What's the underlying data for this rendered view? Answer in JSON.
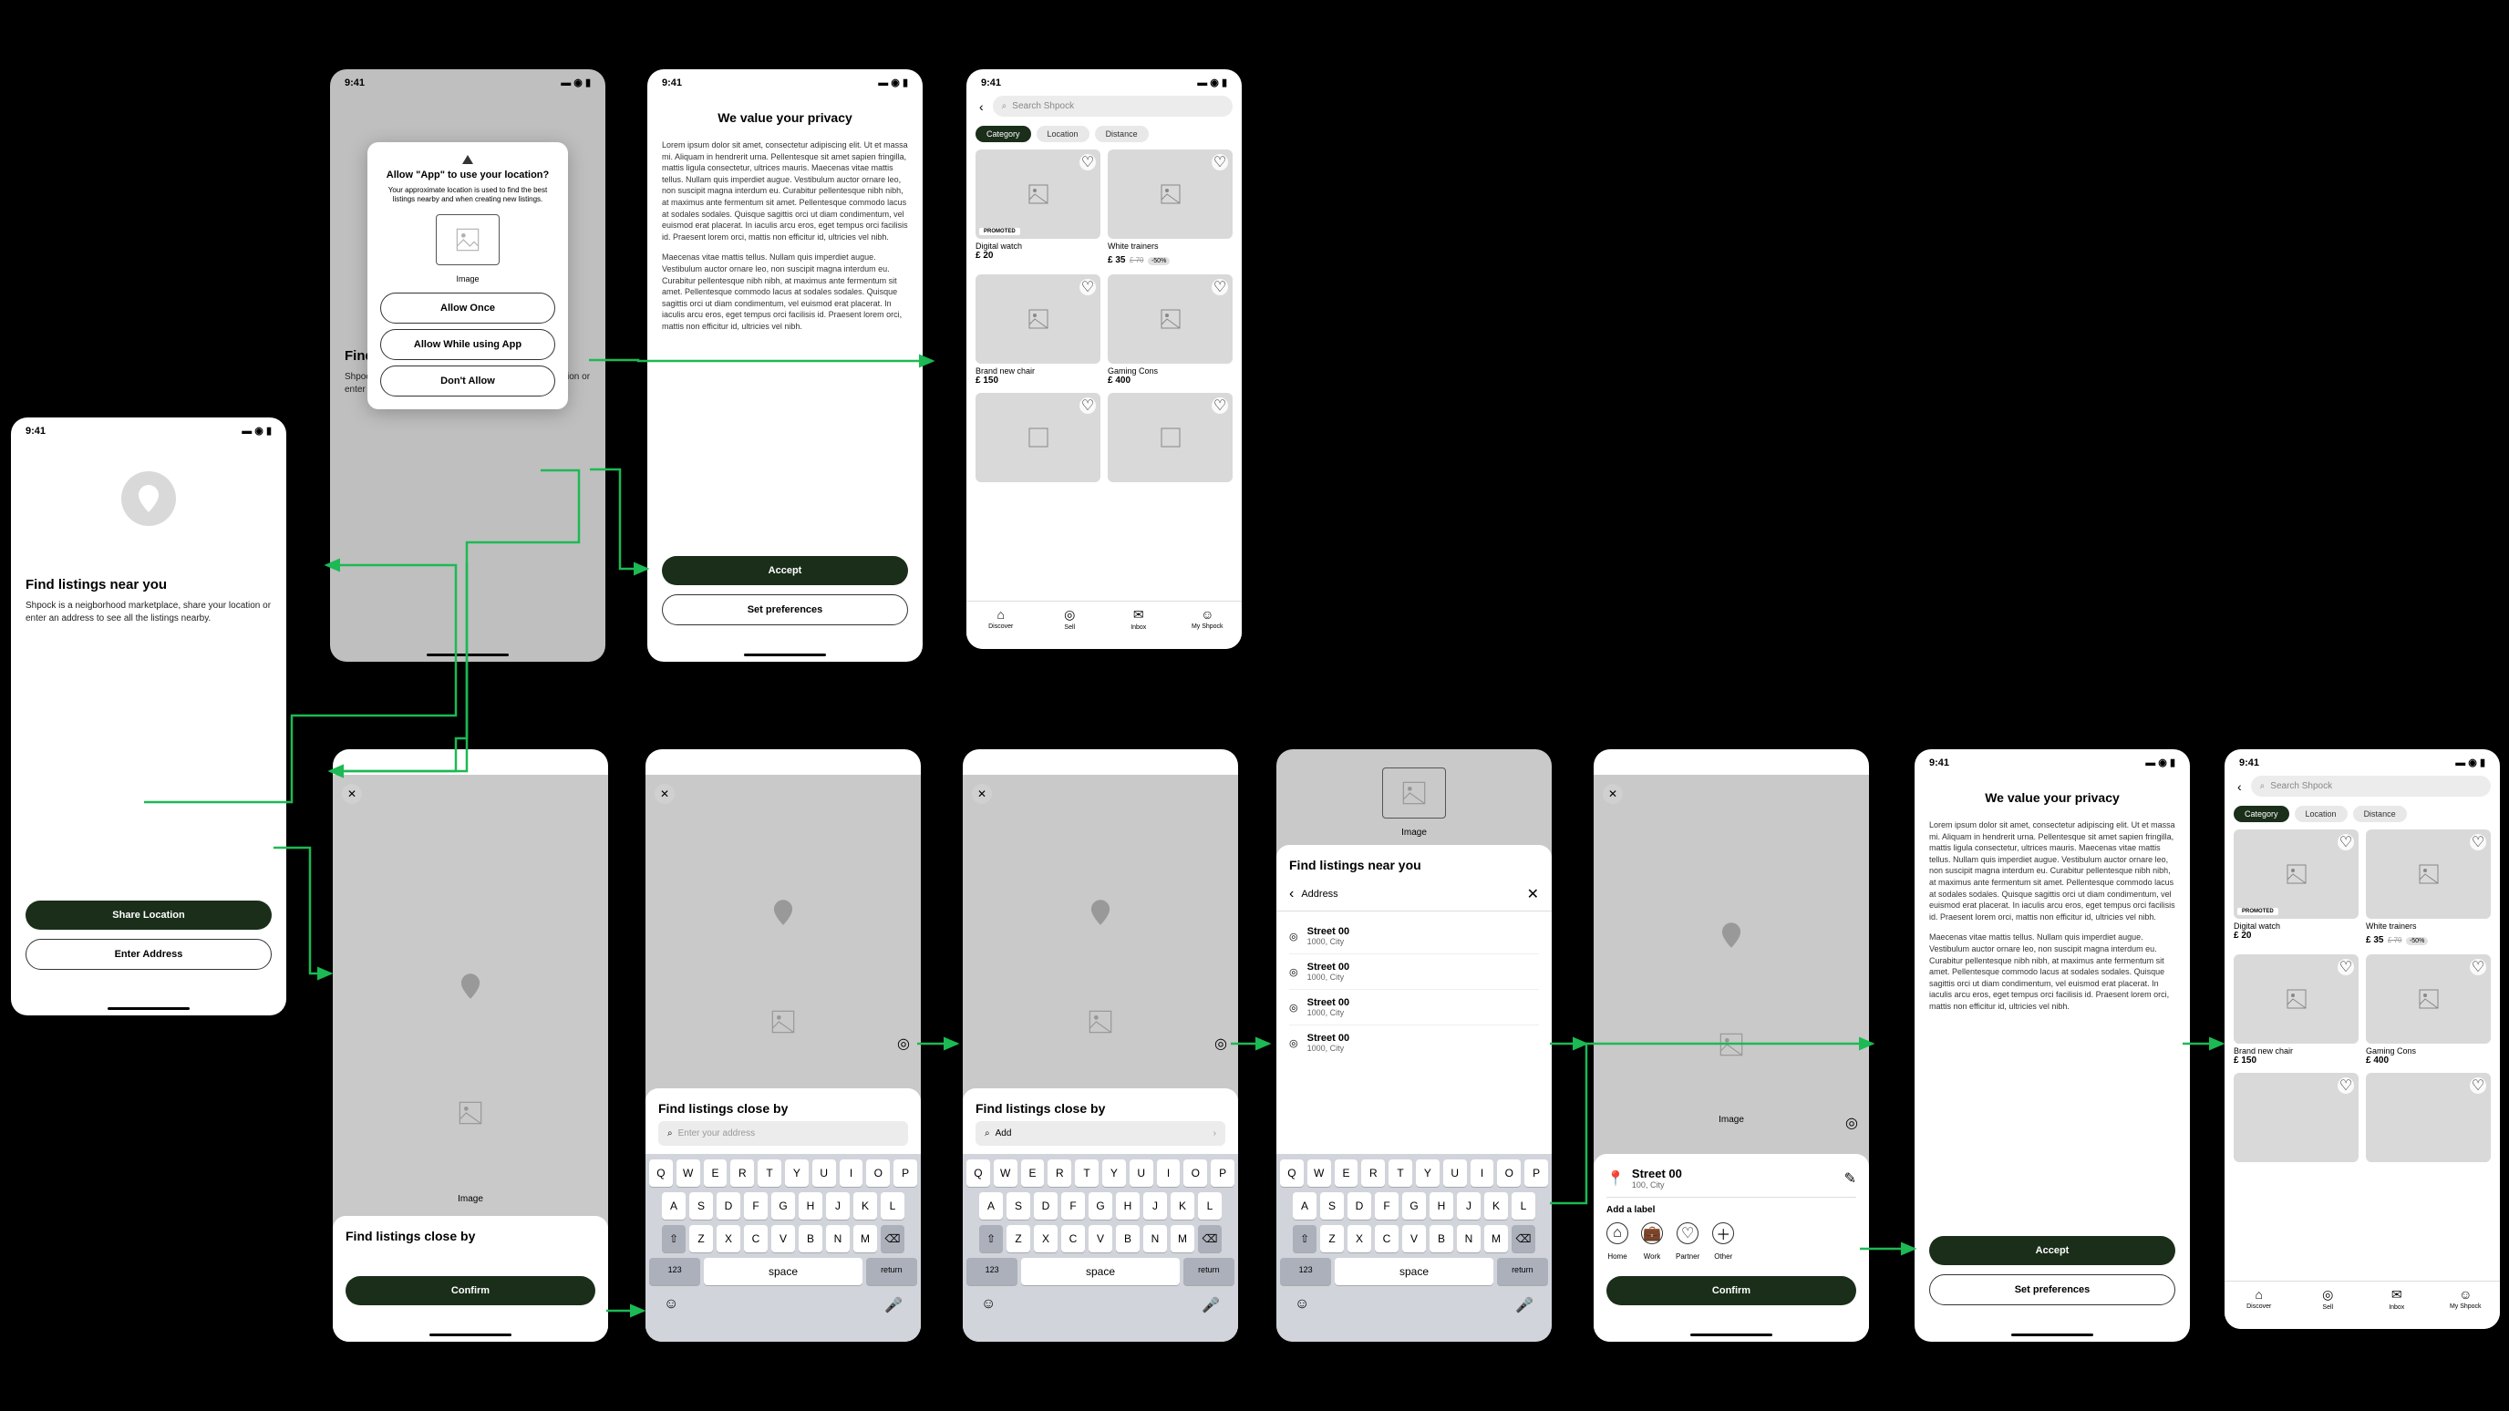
{
  "status_time": "9:41",
  "screen1": {
    "title": "Find listings near you",
    "body": "Shpock is a neigborhood marketplace, share your location or enter an address to see all the listings nearby.",
    "btn_share": "Share Location",
    "btn_enter": "Enter Address"
  },
  "screen2": {
    "dialog_title": "Allow \"App\" to use your location?",
    "dialog_body": "Your approximate location is used to find the best listings nearby and when creating new listings.",
    "image_label": "Image",
    "btn_once": "Allow Once",
    "btn_while": "Allow While using App",
    "btn_deny": "Don't Allow",
    "bg_title": "Find "
  },
  "privacy": {
    "title": "We value your privacy",
    "body1": "Lorem ipsum dolor sit amet, consectetur adipiscing elit. Ut et massa mi. Aliquam in hendrerit urna. Pellentesque sit amet sapien fringilla, mattis ligula consectetur, ultrices mauris. Maecenas vitae mattis tellus. Nullam quis imperdiet augue. Vestibulum auctor ornare leo, non suscipit magna interdum eu. Curabitur pellentesque nibh nibh, at maximus ante fermentum sit amet. Pellentesque commodo lacus at sodales sodales. Quisque sagittis orci ut diam condimentum, vel euismod erat placerat. In iaculis arcu eros, eget tempus orci facilisis id. Praesent lorem orci, mattis non efficitur id, ultricies vel nibh.",
    "body2": "Maecenas vitae mattis tellus. Nullam quis imperdiet augue. Vestibulum auctor ornare leo, non suscipit magna interdum eu. Curabitur pellentesque nibh nibh, at maximus ante fermentum sit amet. Pellentesque commodo lacus at sodales sodales. Quisque sagittis orci ut diam condimentum, vel euismod erat placerat. In iaculis arcu eros, eget tempus orci facilisis id. Praesent lorem orci, mattis non efficitur id, ultricies vel nibh.",
    "btn_accept": "Accept",
    "btn_prefs": "Set preferences"
  },
  "listings": {
    "search_placeholder": "Search Shpock",
    "pills": [
      "Category",
      "Location",
      "Distance"
    ],
    "products": [
      {
        "title": "Digital watch",
        "price": "£ 20",
        "promoted": true
      },
      {
        "title": "White trainers",
        "price": "£ 35",
        "strike": "£ 70",
        "discount": "-50%"
      },
      {
        "title": "Brand new chair",
        "price": "£ 150"
      },
      {
        "title": "Gaming Cons",
        "price": "£ 400"
      }
    ],
    "tabs": [
      {
        "label": "Discover",
        "icon": "home"
      },
      {
        "label": "Sell",
        "icon": "camera"
      },
      {
        "label": "Inbox",
        "icon": "mail"
      },
      {
        "label": "My Shpock",
        "icon": "user"
      }
    ]
  },
  "map_sheet": {
    "image_label": "Image",
    "title": "Find listings close by",
    "btn_confirm": "Confirm",
    "input_placeholder": "Enter your address",
    "input_value": "Add"
  },
  "addr_sheet": {
    "title": "Find listings near you",
    "input_value": "Address",
    "options": [
      {
        "main": "Street 00",
        "sub": "1000, City"
      },
      {
        "main": "Street 00",
        "sub": "1000, City"
      },
      {
        "main": "Street 00",
        "sub": "1000, City"
      },
      {
        "main": "Street 00",
        "sub": "1000, City"
      }
    ]
  },
  "save_sheet": {
    "street": "Street 00",
    "city": "100, City",
    "add_label": "Add a label",
    "chips": [
      "Home",
      "Work",
      "Partner",
      "Other"
    ]
  },
  "keyboard": {
    "row1": [
      "Q",
      "W",
      "E",
      "R",
      "T",
      "Y",
      "U",
      "I",
      "O",
      "P"
    ],
    "row2": [
      "A",
      "S",
      "D",
      "F",
      "G",
      "H",
      "J",
      "K",
      "L"
    ],
    "row3": [
      "Z",
      "X",
      "C",
      "V",
      "B",
      "N",
      "M"
    ],
    "num": "123",
    "space": "space",
    "ret": "return"
  }
}
